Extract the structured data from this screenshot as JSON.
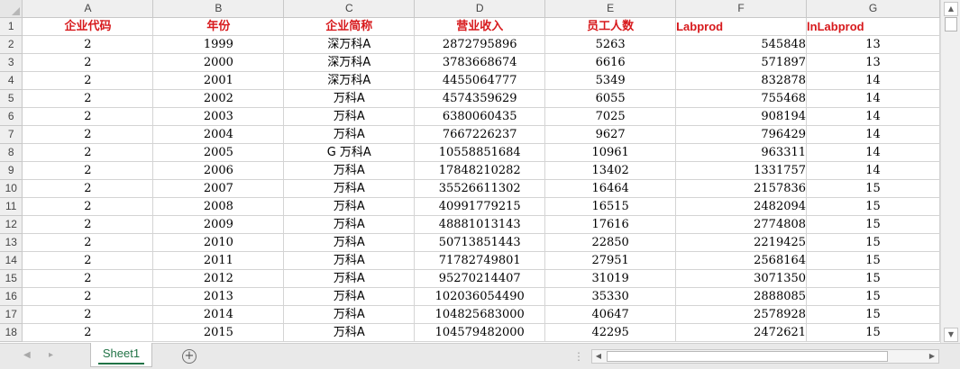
{
  "columns": [
    "A",
    "B",
    "C",
    "D",
    "E",
    "F",
    "G"
  ],
  "header_row": {
    "row": "1",
    "cells": [
      "企业代码",
      "年份",
      "企业简称",
      "营业收入",
      "员工人数",
      "Labprod",
      "lnLabprod"
    ]
  },
  "rows": [
    {
      "row": "2",
      "cells": [
        "2",
        "1999",
        "深万科A",
        "2872795896",
        "5263",
        "545848",
        "13"
      ]
    },
    {
      "row": "3",
      "cells": [
        "2",
        "2000",
        "深万科A",
        "3783668674",
        "6616",
        "571897",
        "13"
      ]
    },
    {
      "row": "4",
      "cells": [
        "2",
        "2001",
        "深万科A",
        "4455064777",
        "5349",
        "832878",
        "14"
      ]
    },
    {
      "row": "5",
      "cells": [
        "2",
        "2002",
        "万科A",
        "4574359629",
        "6055",
        "755468",
        "14"
      ]
    },
    {
      "row": "6",
      "cells": [
        "2",
        "2003",
        "万科A",
        "6380060435",
        "7025",
        "908194",
        "14"
      ]
    },
    {
      "row": "7",
      "cells": [
        "2",
        "2004",
        "万科A",
        "7667226237",
        "9627",
        "796429",
        "14"
      ]
    },
    {
      "row": "8",
      "cells": [
        "2",
        "2005",
        "G 万科A",
        "10558851684",
        "10961",
        "963311",
        "14"
      ]
    },
    {
      "row": "9",
      "cells": [
        "2",
        "2006",
        "万科A",
        "17848210282",
        "13402",
        "1331757",
        "14"
      ]
    },
    {
      "row": "10",
      "cells": [
        "2",
        "2007",
        "万科A",
        "35526611302",
        "16464",
        "2157836",
        "15"
      ]
    },
    {
      "row": "11",
      "cells": [
        "2",
        "2008",
        "万科A",
        "40991779215",
        "16515",
        "2482094",
        "15"
      ]
    },
    {
      "row": "12",
      "cells": [
        "2",
        "2009",
        "万科A",
        "48881013143",
        "17616",
        "2774808",
        "15"
      ]
    },
    {
      "row": "13",
      "cells": [
        "2",
        "2010",
        "万科A",
        "50713851443",
        "22850",
        "2219425",
        "15"
      ]
    },
    {
      "row": "14",
      "cells": [
        "2",
        "2011",
        "万科A",
        "71782749801",
        "27951",
        "2568164",
        "15"
      ]
    },
    {
      "row": "15",
      "cells": [
        "2",
        "2012",
        "万科A",
        "95270214407",
        "31019",
        "3071350",
        "15"
      ]
    },
    {
      "row": "16",
      "cells": [
        "2",
        "2013",
        "万科A",
        "102036054490",
        "35330",
        "2888085",
        "15"
      ]
    },
    {
      "row": "17",
      "cells": [
        "2",
        "2014",
        "万科A",
        "104825683000",
        "40647",
        "2578928",
        "15"
      ]
    },
    {
      "row": "18",
      "cells": [
        "2",
        "2015",
        "万科A",
        "104579482000",
        "42295",
        "2472621",
        "15"
      ]
    }
  ],
  "sheet_tab": "Sheet1",
  "icons": {
    "first": "◀",
    "prev": "▸",
    "add": "+",
    "splitter": "⋮",
    "scroll_up": "▲",
    "scroll_down": "▼",
    "scroll_left": "◀",
    "scroll_right": "▶"
  },
  "colors": {
    "header_text": "#d7191c",
    "tab_accent": "#217346"
  }
}
